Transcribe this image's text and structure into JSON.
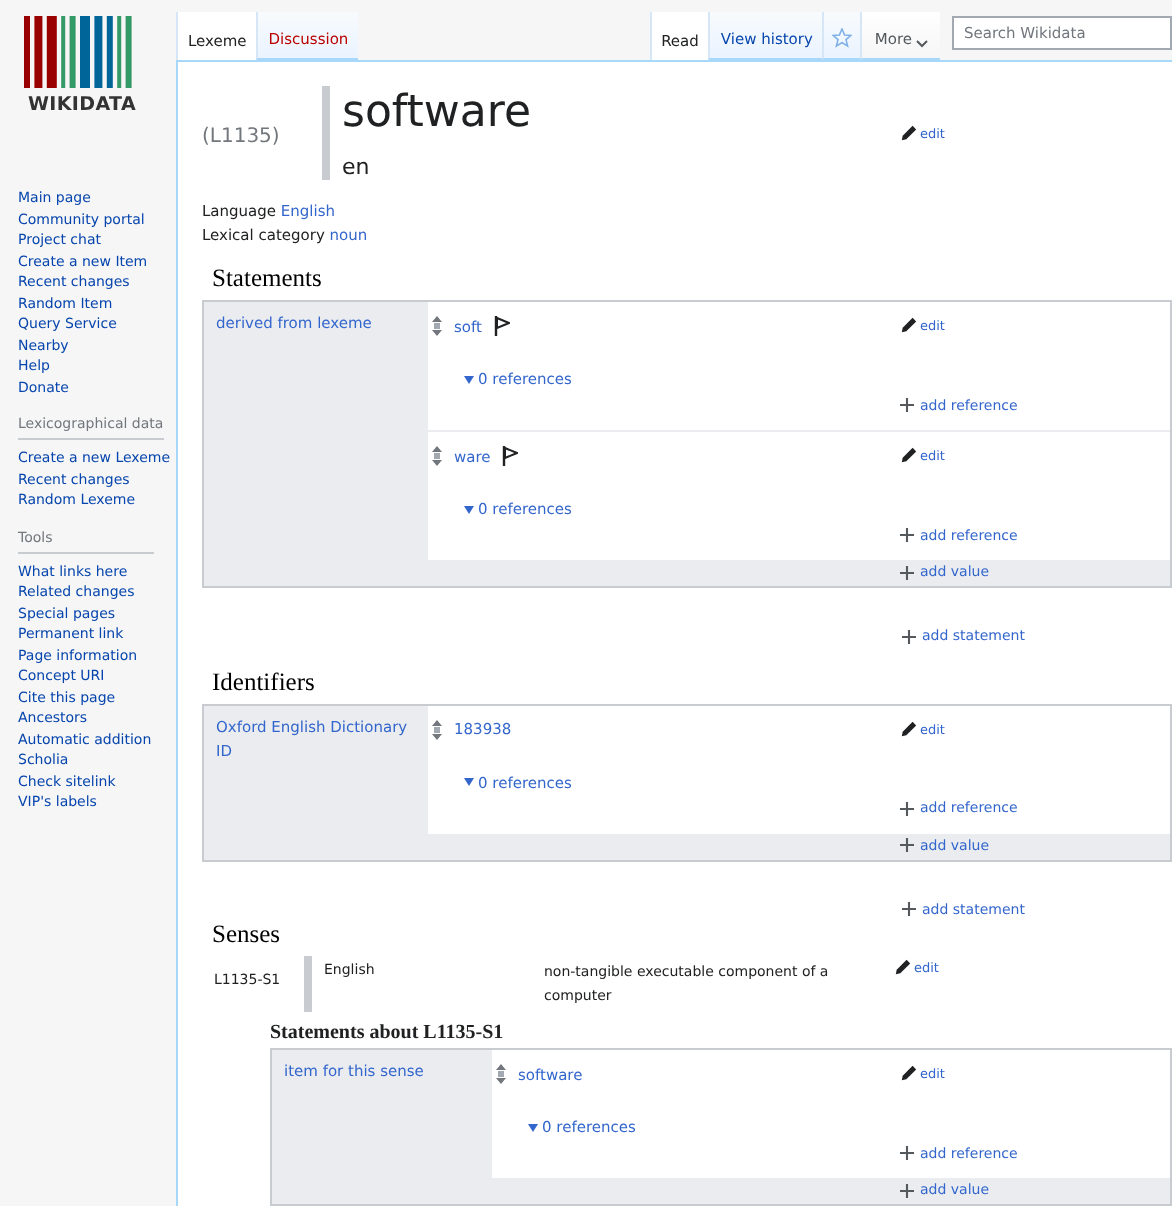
{
  "sidebar": {
    "logo": "WIKIDATA",
    "navigation": [
      "Main page",
      "Community portal",
      "Project chat",
      "Create a new Item",
      "Recent changes",
      "Random Item",
      "Query Service",
      "Nearby",
      "Help",
      "Donate"
    ],
    "portals": [
      {
        "heading": "Lexicographical data",
        "items": [
          "Create a new Lexeme",
          "Recent changes",
          "Random Lexeme"
        ]
      },
      {
        "heading": "Tools",
        "items": [
          "What links here",
          "Related changes",
          "Special pages",
          "Permanent link",
          "Page information",
          "Concept URI",
          "Cite this page",
          "Ancestors",
          "Automatic addition",
          "Scholia",
          "Check sitelink",
          "VIP's labels"
        ]
      }
    ]
  },
  "tabs": {
    "left": [
      {
        "label": "Lexeme",
        "selected": true,
        "kind": "page"
      },
      {
        "label": "Discussion",
        "selected": false,
        "kind": "missing"
      }
    ],
    "right": [
      {
        "label": "Read",
        "selected": true
      },
      {
        "label": "View history",
        "selected": false
      }
    ],
    "more": "More",
    "search": {
      "placeholder": "Search Wikidata"
    }
  },
  "lexeme": {
    "id": "(L1135)",
    "lemma": "software",
    "language_code": "en",
    "edit": "edit",
    "language_label": "Language",
    "language": "English",
    "category_label": "Lexical category",
    "category": "noun"
  },
  "statements": {
    "heading": "Statements",
    "groups": [
      {
        "property": "derived from lexeme",
        "add_value": "add value",
        "values": [
          {
            "value": "soft",
            "flag": true,
            "references": "0 references",
            "edit": "edit",
            "add_reference": "add reference"
          },
          {
            "value": "ware",
            "flag": true,
            "references": "0 references",
            "edit": "edit",
            "add_reference": "add reference"
          }
        ]
      }
    ],
    "add_statement": "add statement"
  },
  "identifiers": {
    "heading": "Identifiers",
    "groups": [
      {
        "property": "Oxford English Dictionary ID",
        "add_value": "add value",
        "values": [
          {
            "value": "183938",
            "flag": false,
            "references": "0 references",
            "edit": "edit",
            "add_reference": "add reference"
          }
        ]
      }
    ],
    "add_statement": "add statement"
  },
  "senses": {
    "heading": "Senses",
    "items": [
      {
        "id": "L1135-S1",
        "gloss_language": "English",
        "gloss": "non-tangible executable component of a computer",
        "edit": "edit",
        "statements_heading": "Statements about L1135-S1",
        "groups": [
          {
            "property": "item for this sense",
            "add_value": "add value",
            "values": [
              {
                "value": "software",
                "flag": false,
                "references": "0 references",
                "edit": "edit",
                "add_reference": "add reference"
              }
            ]
          }
        ]
      }
    ]
  }
}
